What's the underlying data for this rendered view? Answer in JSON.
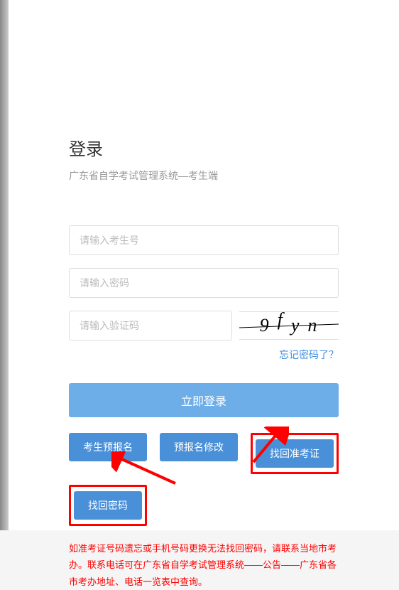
{
  "title": "登录",
  "subtitle": "广东省自学考试管理系统—考生端",
  "inputs": {
    "exam_no_placeholder": "请输入考生号",
    "password_placeholder": "请输入密码",
    "captcha_placeholder": "请输入验证码",
    "captcha_text": "9fyn"
  },
  "links": {
    "forgot": "忘记密码了？"
  },
  "buttons": {
    "login": "立即登录",
    "pre_register": "考生预报名",
    "modify_pre_register": "预报名修改",
    "find_admission_ticket": "找回准考证",
    "find_password": "找回密码"
  },
  "note": "如准考证号码遗忘或手机号码更换无法找回密码，请联系当地市考办。联系电话可在广东省自学考试管理系统——公告——广东省各市考办地址、电话一览表中查询。"
}
